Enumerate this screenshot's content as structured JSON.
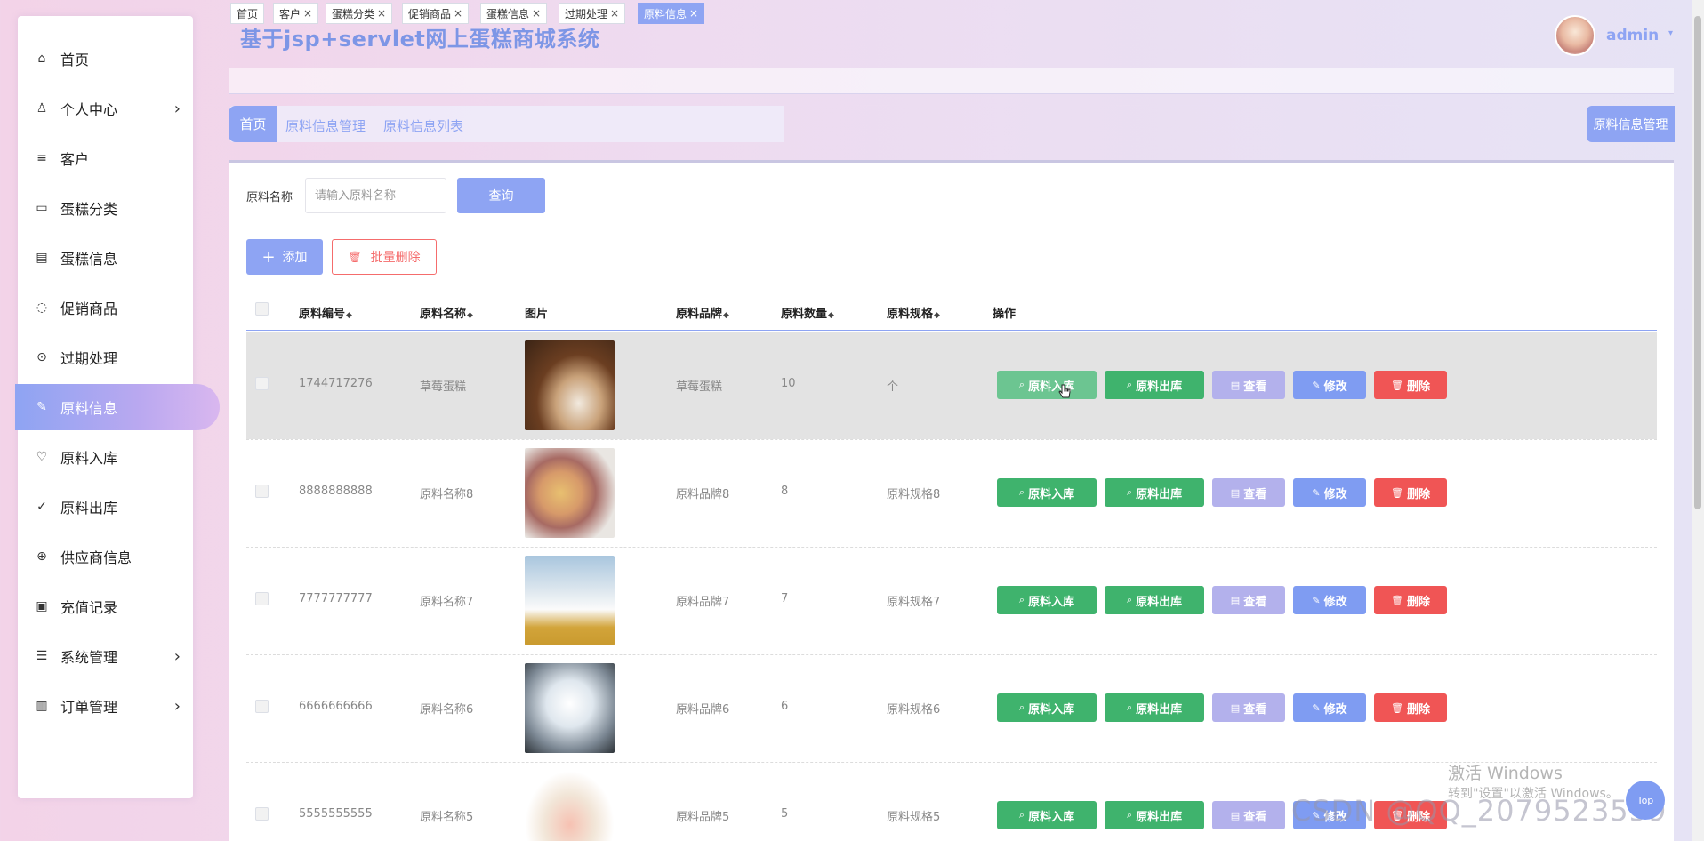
{
  "app_title": "基于jsp+servlet网上蛋糕商城系统",
  "user": {
    "name": "admin"
  },
  "sidebar": {
    "items": [
      {
        "label": "首页",
        "icon": "home-icon"
      },
      {
        "label": "个人中心",
        "icon": "user-icon",
        "has_arrow": true
      },
      {
        "label": "客户",
        "icon": "list-icon"
      },
      {
        "label": "蛋糕分类",
        "icon": "category-icon"
      },
      {
        "label": "蛋糕信息",
        "icon": "info-icon"
      },
      {
        "label": "促销商品",
        "icon": "chat-icon"
      },
      {
        "label": "过期处理",
        "icon": "warning-icon"
      },
      {
        "label": "原料信息",
        "icon": "edit-icon",
        "active": true
      },
      {
        "label": "原料入库",
        "icon": "heart-icon"
      },
      {
        "label": "原料出库",
        "icon": "check-circle-icon"
      },
      {
        "label": "供应商信息",
        "icon": "plus-circle-icon"
      },
      {
        "label": "充值记录",
        "icon": "picture-icon"
      },
      {
        "label": "系统管理",
        "icon": "menu-icon",
        "has_arrow": true
      },
      {
        "label": "订单管理",
        "icon": "chart-icon",
        "has_arrow": true
      }
    ]
  },
  "tags": [
    {
      "label": "首页",
      "closable": false
    },
    {
      "label": "客户",
      "closable": true
    },
    {
      "label": "蛋糕分类",
      "closable": true
    },
    {
      "label": "促销商品",
      "closable": true
    },
    {
      "label": "蛋糕信息",
      "closable": true
    },
    {
      "label": "过期处理",
      "closable": true
    },
    {
      "label": "原料信息",
      "closable": true,
      "active": true
    }
  ],
  "breadcrumb": {
    "home": "首页",
    "items": [
      "原料信息管理",
      "原料信息列表"
    ],
    "right_label": "原料信息管理"
  },
  "search": {
    "label": "原料名称",
    "placeholder": "请输入原料名称",
    "value": "",
    "button": "查询"
  },
  "toolbar": {
    "add_label": "添加",
    "batch_delete_label": "批量删除"
  },
  "table": {
    "columns": [
      "原料编号",
      "原料名称",
      "图片",
      "原料品牌",
      "原料数量",
      "原料规格",
      "操作"
    ],
    "actions": {
      "in": "原料入库",
      "out": "原料出库",
      "view": "查看",
      "edit": "修改",
      "delete": "删除"
    },
    "rows": [
      {
        "code": "1744717276",
        "name": "草莓蛋糕",
        "brand": "草莓蛋糕",
        "qty": "10",
        "spec": "个",
        "image": "cake-thumbnail"
      },
      {
        "code": "8888888888",
        "name": "原料名称8",
        "brand": "原料品牌8",
        "qty": "8",
        "spec": "原料规格8",
        "image": "pastry-thumbnail"
      },
      {
        "code": "7777777777",
        "name": "原料名称7",
        "brand": "原料品牌7",
        "qty": "7",
        "spec": "原料规格7",
        "image": "ice-thumbnail"
      },
      {
        "code": "6666666666",
        "name": "原料名称6",
        "brand": "原料品牌6",
        "qty": "6",
        "spec": "原料规格6",
        "image": "pearl-thumbnail"
      },
      {
        "code": "5555555555",
        "name": "原料名称5",
        "brand": "原料品牌5",
        "qty": "5",
        "spec": "原料规格5",
        "image": "dessert-thumbnail"
      }
    ]
  },
  "watermark": {
    "line1": "激活 Windows",
    "line2": "转到\"设置\"以激活 Windows。",
    "csdn": "CSDN @QQ_2079523559"
  },
  "float_button": "Top",
  "colors": {
    "accent": "#8ea4f3",
    "success": "#3fb36d",
    "danger": "#f05555",
    "title": "#7d96e6"
  }
}
